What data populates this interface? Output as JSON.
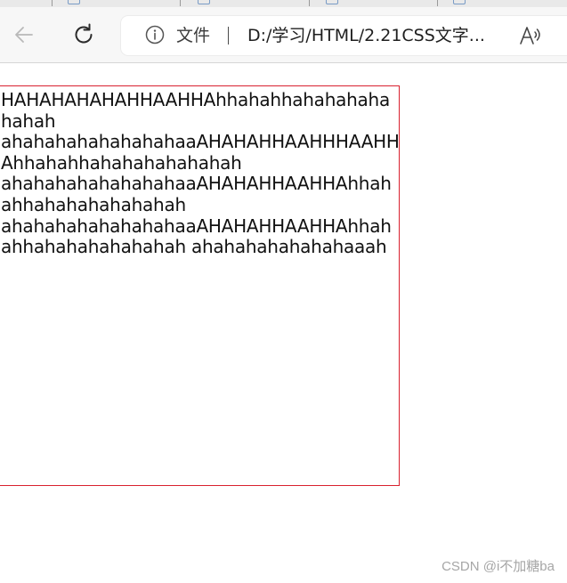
{
  "browser": {
    "address_bar": {
      "scheme_label": "文件",
      "url": "D:/学习/HTML/2.21CSS文字..."
    }
  },
  "page": {
    "paragraph": "HAHAHAHAHAHHAAHHAhhahahhahahahahahahah ahahahahahahahahaaAHAHAHHAAHHHAAHHAhhahahhahahahahahahah ahahahahahahahahaaAHAHAHHAAHHAhhahahhahahahahahahah ahahahahahahahahaaAHAHAHHAAHHAhhahahhahahahahahahah ahahahahahahahaaah"
  },
  "watermark": {
    "text": "CSDN @i不加糖ba"
  }
}
